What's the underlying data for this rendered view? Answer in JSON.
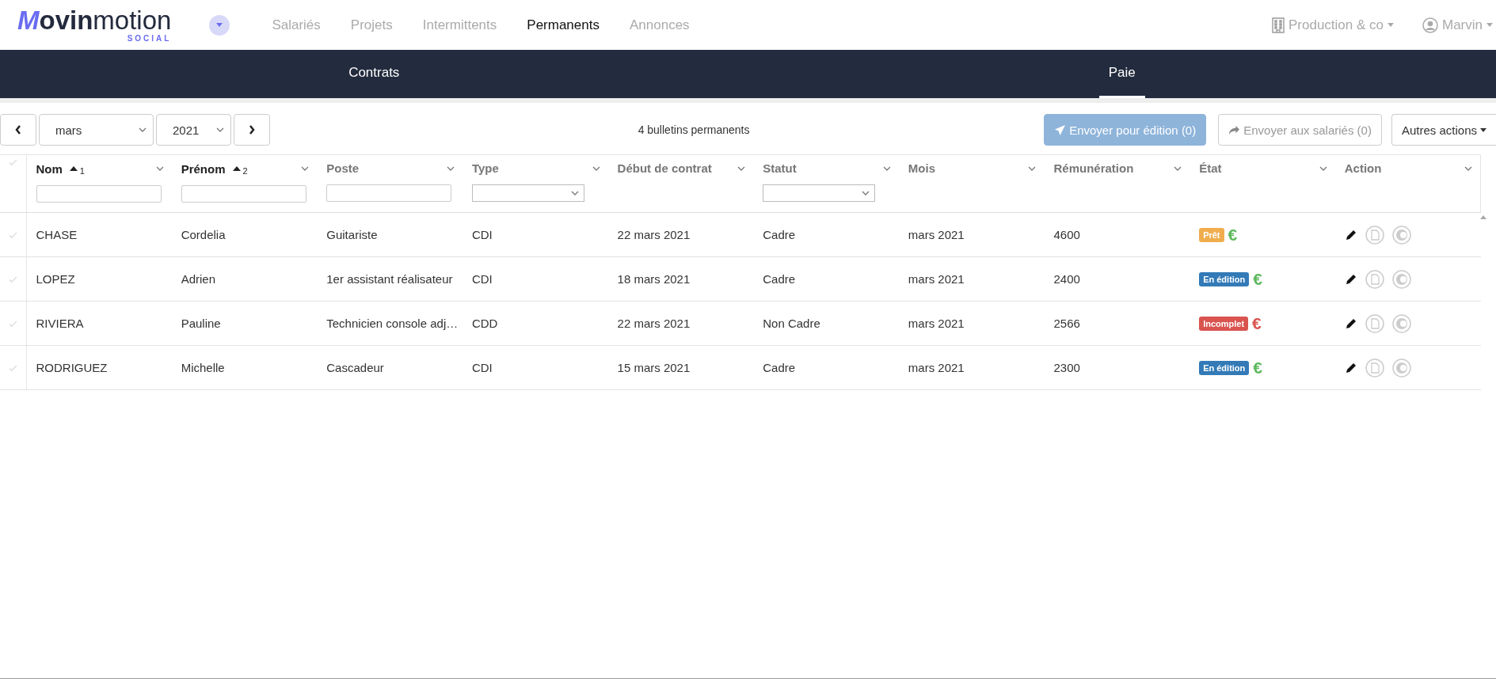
{
  "brand": {
    "initial": "M",
    "bold": "ovin",
    "light": "motion",
    "tagline": "SOCIAL"
  },
  "top_nav": [
    {
      "label": "Salariés",
      "selected": false
    },
    {
      "label": "Projets",
      "selected": false
    },
    {
      "label": "Intermittents",
      "selected": false
    },
    {
      "label": "Permanents",
      "selected": true
    },
    {
      "label": "Annonces",
      "selected": false
    }
  ],
  "company": {
    "label": "Production & co"
  },
  "user": {
    "label": "Marvin"
  },
  "sub_nav": [
    {
      "label": "Contrats",
      "selected": false
    },
    {
      "label": "Paie",
      "selected": true
    }
  ],
  "toolbar": {
    "month": "mars",
    "year": "2021",
    "count": "4 bulletins permanents",
    "buttons": [
      {
        "label": "Envoyer pour édition (0)",
        "kind": "primary",
        "disabled": true
      },
      {
        "label": "Envoyer aux salariés (0)",
        "kind": "share",
        "disabled": true
      },
      {
        "label": "Autres actions",
        "kind": "dropdown",
        "disabled": false
      }
    ]
  },
  "table": {
    "columns": [
      {
        "label": "Nom",
        "sorted": true,
        "sort_order": "1",
        "kind": "text"
      },
      {
        "label": "Prénom",
        "sorted": true,
        "sort_order": "2",
        "kind": "text"
      },
      {
        "label": "Poste",
        "sorted": false,
        "kind": "text"
      },
      {
        "label": "Type",
        "sorted": false,
        "kind": "select"
      },
      {
        "label": "Début de contrat",
        "sorted": false,
        "kind": "plain"
      },
      {
        "label": "Statut",
        "sorted": false,
        "kind": "select"
      },
      {
        "label": "Mois",
        "sorted": false,
        "kind": "plain"
      },
      {
        "label": "Rémunération",
        "sorted": false,
        "kind": "plain"
      },
      {
        "label": "État",
        "sorted": false,
        "kind": "plain"
      },
      {
        "label": "Action",
        "sorted": false,
        "kind": "plain"
      }
    ],
    "rows": [
      {
        "selected": false,
        "cells": [
          "CHASE",
          "Cordelia",
          "Guitariste",
          "CDI",
          "22 mars 2021",
          "Cadre",
          "mars 2021",
          "4600"
        ],
        "state": {
          "label": "Prêt",
          "color": "#f0ad4e"
        },
        "euro": {
          "text": "€",
          "color": "#5cb85c"
        }
      },
      {
        "selected": false,
        "cells": [
          "LOPEZ",
          "Adrien",
          "1er assistant réalisateur",
          "CDI",
          "18 mars 2021",
          "Cadre",
          "mars 2021",
          "2400"
        ],
        "state": {
          "label": "En édition",
          "color": "#337ab7"
        },
        "euro": {
          "text": "€",
          "color": "#5cb85c"
        }
      },
      {
        "selected": false,
        "cells": [
          "RIVIERA",
          "Pauline",
          "Technicien console adj…",
          "CDD",
          "22 mars 2021",
          "Non Cadre",
          "mars 2021",
          "2566"
        ],
        "state": {
          "label": "Incomplet",
          "color": "#d9534f"
        },
        "euro": {
          "text": "€",
          "color": "#d9534f"
        }
      },
      {
        "selected": false,
        "cells": [
          "RODRIGUEZ",
          "Michelle",
          "Cascadeur",
          "CDI",
          "15 mars 2021",
          "Cadre",
          "mars 2021",
          "2300"
        ],
        "state": {
          "label": "En édition",
          "color": "#337ab7"
        },
        "euro": {
          "text": "€",
          "color": "#5cb85c"
        }
      }
    ]
  }
}
